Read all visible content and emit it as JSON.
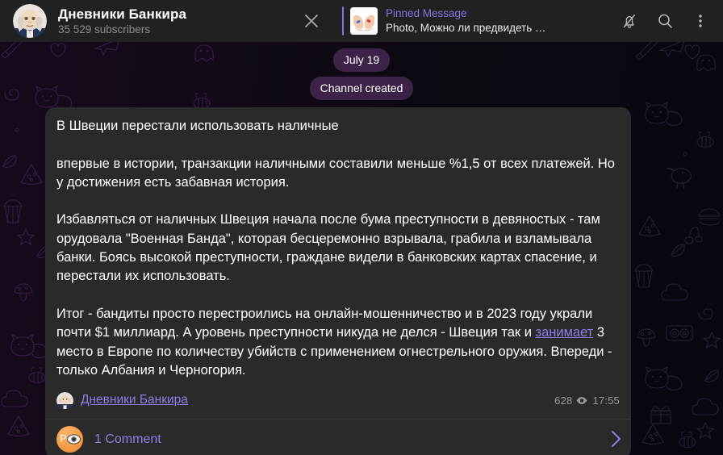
{
  "header": {
    "channel_name": "Дневники Банкира",
    "subscribers": "35 529 subscribers",
    "avatar_icon": "benjamin-franklin-portrait",
    "close_icon": "close-icon",
    "pinned": {
      "title": "Pinned Message",
      "preview": "Photo, Можно ли предвидеть …",
      "thumb_icon": "hands-with-pills-photo"
    },
    "actions": [
      {
        "name": "mute-toggle",
        "icon": "bell-muted-icon"
      },
      {
        "name": "search",
        "icon": "search-icon"
      },
      {
        "name": "more-options",
        "icon": "dots-vertical-icon"
      }
    ]
  },
  "chat": {
    "date_divider": "July 19",
    "service_message": "Channel created",
    "wallpaper_icon": "doodle-pattern-background"
  },
  "message": {
    "text_part_1": "В Швеции перестали использовать наличные\n\nвпервые в истории, транзакции наличными составили меньше %1,5 от всех платежей. Но у достижения есть забавная история.\n\nИзбавляться от наличных Швеция начала после бума преступности в девяностых - там орудовала \"Военная Банда\", которая бесцеремонно взрывала, грабила и взламывала банки. Боясь высокой преступности, граждане видели в банковских картах спасение, и перестали их использовать.\n\nИтог - бандиты просто перестроились на онлайн-мошенничество и в 2023 году украли почти $1 миллиард. А уровень преступности никуда не делся - Швеция так и ",
    "link_text": "занимает",
    "text_part_2": " 3 место в Европе по количеству убийств с применением огнестрельного оружия. Впереди - только Албания и Черногория.",
    "signature_name": "Дневники Банкира",
    "signature_avatar_icon": "benjamin-franklin-portrait",
    "views": "628",
    "views_icon": "eye-icon",
    "time": "17:55",
    "comments": {
      "label": "1 Comment",
      "avatar_letter": "P",
      "avatar_icon": "eye-emoji-avatar",
      "chevron_icon": "chevron-right-icon"
    }
  },
  "colors": {
    "accent_purple": "#8774e1",
    "link_purple": "#8b7fe8",
    "bubble_bg": "#2a2a2a",
    "header_bg": "#212121",
    "comment_avatar_orange": "#f59a44"
  }
}
